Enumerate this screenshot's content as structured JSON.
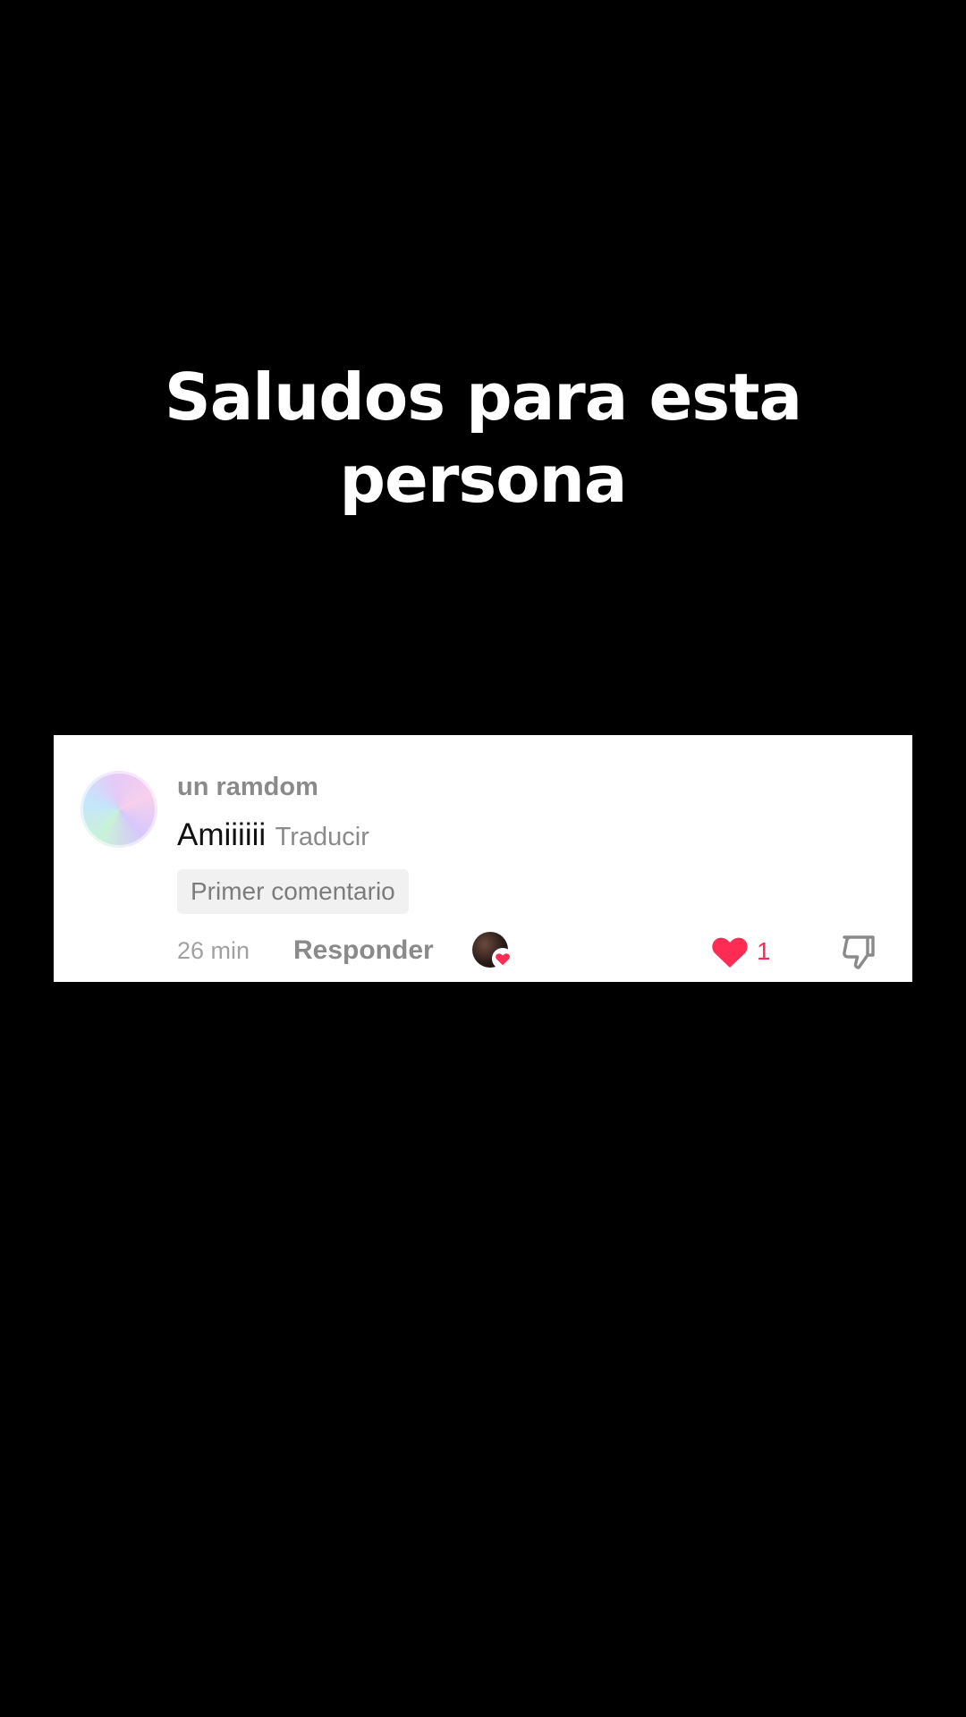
{
  "caption": {
    "line1": "Saludos para esta",
    "line2": "persona"
  },
  "comment": {
    "username": "un ramdom",
    "text": "Amiiiiii",
    "translate_label": "Traducir",
    "badge": "Primer comentario",
    "timestamp": "26 min",
    "reply_label": "Responder",
    "like_count": "1",
    "icons": {
      "avatar": "user-avatar-gradient",
      "creator_liked": "creator-avatar-with-heart-icon",
      "like": "heart-icon",
      "dislike": "thumbs-down-icon"
    }
  },
  "colors": {
    "background": "#000000",
    "card": "#ffffff",
    "accent_like": "#fe2c55",
    "muted_text": "#8a8a8a"
  }
}
